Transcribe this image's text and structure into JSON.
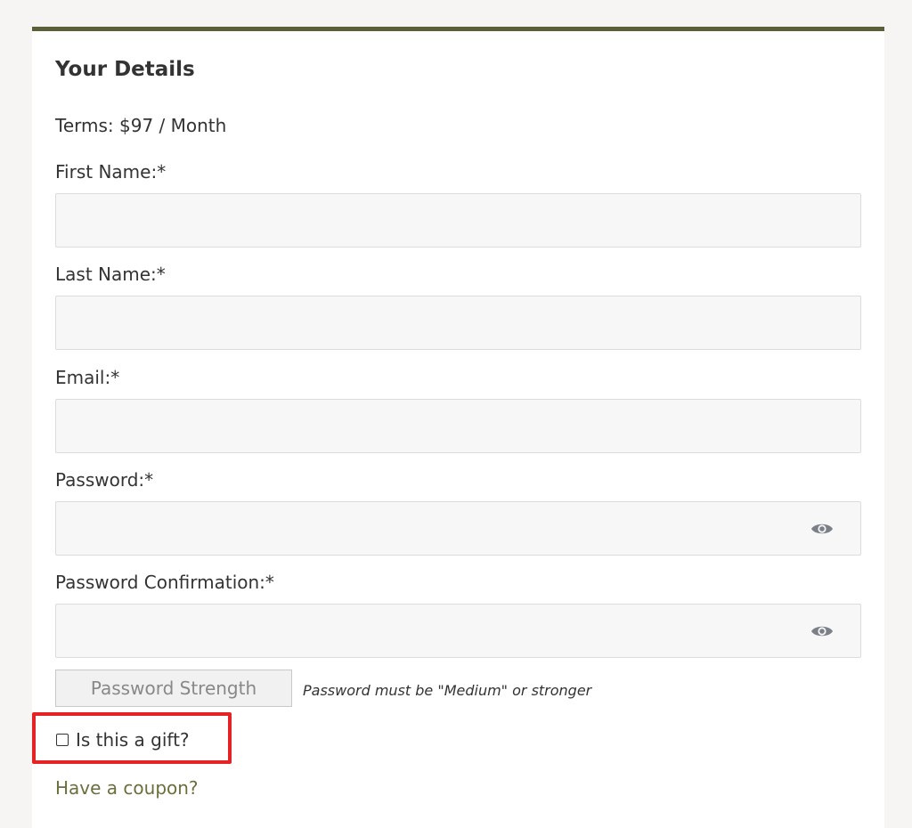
{
  "form": {
    "title": "Your Details",
    "terms": "Terms: $97 / Month",
    "fields": [
      {
        "label": "First Name:*",
        "value": "",
        "placeholder": ""
      },
      {
        "label": "Last Name:*",
        "value": "",
        "placeholder": ""
      },
      {
        "label": "Email:*",
        "value": "",
        "placeholder": ""
      },
      {
        "label": "Password:*",
        "value": "",
        "placeholder": "",
        "icon": "eye-icon"
      },
      {
        "label": "Password Confirmation:*",
        "value": "",
        "placeholder": "",
        "icon": "eye-icon"
      }
    ],
    "password_strength_label": "Password Strength",
    "password_strength_note": "Password must be \"Medium\" or stronger",
    "gift_label": "Is this a gift?",
    "gift_checked": false,
    "coupon_link": "Have a coupon?"
  },
  "colors": {
    "accent_border": "#5a5f37",
    "highlight_box": "#e52327",
    "link": "#6b6f3c",
    "page_bg": "#f6f5f3"
  }
}
